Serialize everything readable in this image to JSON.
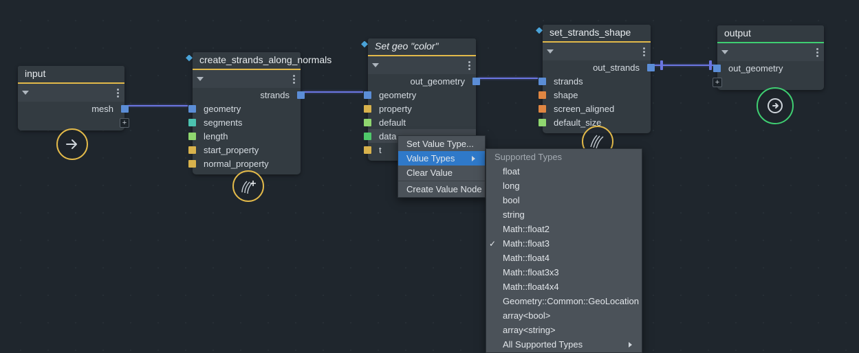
{
  "nodes": {
    "input": {
      "title": "input",
      "ports_out": [
        "mesh"
      ]
    },
    "create_strands": {
      "title": "create_strands_along_normals",
      "ports_out": [
        "strands"
      ],
      "ports_in": [
        "geometry",
        "segments",
        "length",
        "start_property",
        "normal_property"
      ]
    },
    "set_geo": {
      "title": "Set geo \"color\"",
      "ports_out": [
        "out_geometry"
      ],
      "ports_in": [
        "geometry",
        "property",
        "default",
        "data",
        "t"
      ]
    },
    "set_shape": {
      "title": "set_strands_shape",
      "ports_out": [
        "out_strands"
      ],
      "ports_in": [
        "strands",
        "shape",
        "screen_aligned",
        "default_size"
      ]
    },
    "output": {
      "title": "output",
      "ports_in": [
        "out_geometry"
      ]
    }
  },
  "context_menu": {
    "items": [
      {
        "label": "Set Value Type..."
      },
      {
        "label": "Value Types",
        "selected": true,
        "submenu": true
      },
      {
        "label": "Clear Value"
      },
      {
        "label": "Create Value Node"
      }
    ]
  },
  "submenu": {
    "header": "Supported Types",
    "items": [
      {
        "label": "float"
      },
      {
        "label": "long"
      },
      {
        "label": "bool"
      },
      {
        "label": "string"
      },
      {
        "label": "Math::float2"
      },
      {
        "label": "Math::float3",
        "checked": true
      },
      {
        "label": "Math::float4"
      },
      {
        "label": "Math::float3x3"
      },
      {
        "label": "Math::float4x4"
      },
      {
        "label": "Geometry::Common::GeoLocation"
      },
      {
        "label": "array<bool>"
      },
      {
        "label": "array<string>"
      },
      {
        "label": "All Supported Types",
        "submenu": true
      }
    ]
  },
  "colors": {
    "title_yellow": "#e3ba4a",
    "title_green": "#3fcf72"
  }
}
